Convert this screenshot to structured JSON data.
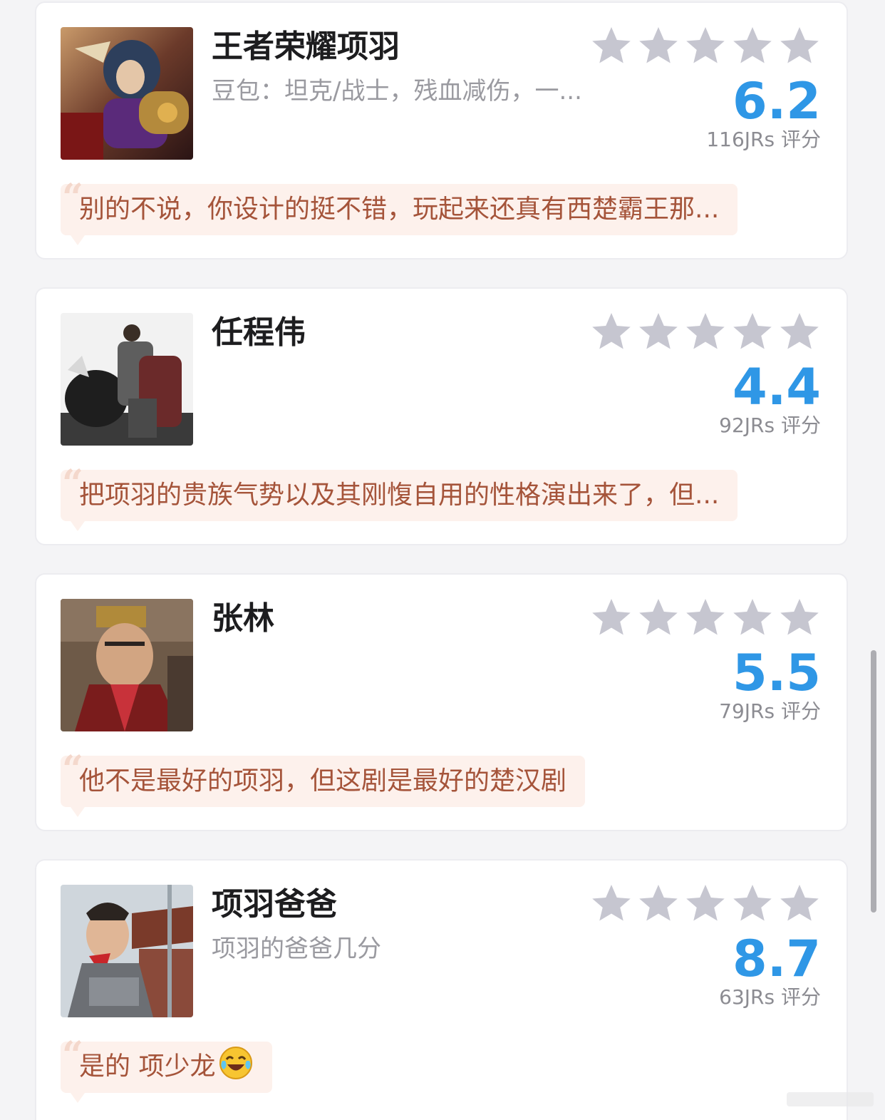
{
  "cards": [
    {
      "name": "王者荣耀项羽",
      "subtitle": "豆包：坦克/战士，残血减伤，一...",
      "score": "6.2",
      "count": "116JRs 评分",
      "comment": "别的不说，你设计的挺不错，玩起来还真有西楚霸王那...",
      "avatar": "game-character-xiang-yu"
    },
    {
      "name": "任程伟",
      "subtitle": "",
      "score": "4.4",
      "count": "92JRs 评分",
      "comment": "把项羽的贵族气势以及其刚愎自用的性格演出来了，但...",
      "avatar": "actor-on-horse"
    },
    {
      "name": "张林",
      "subtitle": "",
      "score": "5.5",
      "count": "79JRs 评分",
      "comment": "他不是最好的项羽，但这剧是最好的楚汉剧",
      "avatar": "actor-portrait"
    },
    {
      "name": "项羽爸爸",
      "subtitle": "项羽的爸爸几分",
      "score": "8.7",
      "count": "63JRs 评分",
      "comment": "是的 项少龙",
      "comment_emoji": "laughing-crying-emoji",
      "avatar": "actor-in-armor"
    }
  ],
  "colors": {
    "score": "#2f97e6",
    "star": "#c6c6d0",
    "quote_bg": "#fdf1ec",
    "quote_text": "#a5543a"
  }
}
